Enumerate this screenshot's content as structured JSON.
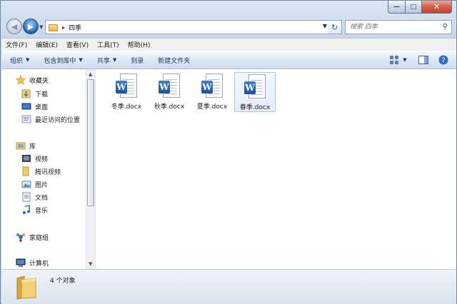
{
  "window": {
    "controls": {
      "minimize": "—",
      "maximize": "□",
      "close": "✕"
    }
  },
  "address": {
    "breadcrumb": "四季",
    "separator": "▸"
  },
  "search": {
    "placeholder": "搜索 四季"
  },
  "menu": [
    {
      "label": "文件(F)"
    },
    {
      "label": "编辑(E)"
    },
    {
      "label": "查看(V)"
    },
    {
      "label": "工具(T)"
    },
    {
      "label": "帮助(H)"
    }
  ],
  "toolbar": {
    "organize": "组织",
    "include": "包含到库中",
    "share": "共享",
    "burn": "刻录",
    "new_folder": "新建文件夹"
  },
  "nav": {
    "favorites": "收藏夹",
    "downloads": "下载",
    "desktop": "桌面",
    "recent": "最近访问的位置",
    "libraries": "库",
    "videos": "视频",
    "tencent_video": "腾讯视频",
    "pictures": "图片",
    "documents": "文档",
    "music": "音乐",
    "homegroup": "家庭组",
    "computer": "计算机"
  },
  "files": [
    {
      "name": "冬季.docx",
      "selected": false
    },
    {
      "name": "秋季.docx",
      "selected": false
    },
    {
      "name": "夏季.docx",
      "selected": false
    },
    {
      "name": "春季.docx",
      "selected": true
    }
  ],
  "status": {
    "count_text": "4 个对象"
  },
  "colors": {
    "accent": "#1f66b5",
    "word_blue": "#2b5fb4",
    "folder": "#e7b443"
  }
}
